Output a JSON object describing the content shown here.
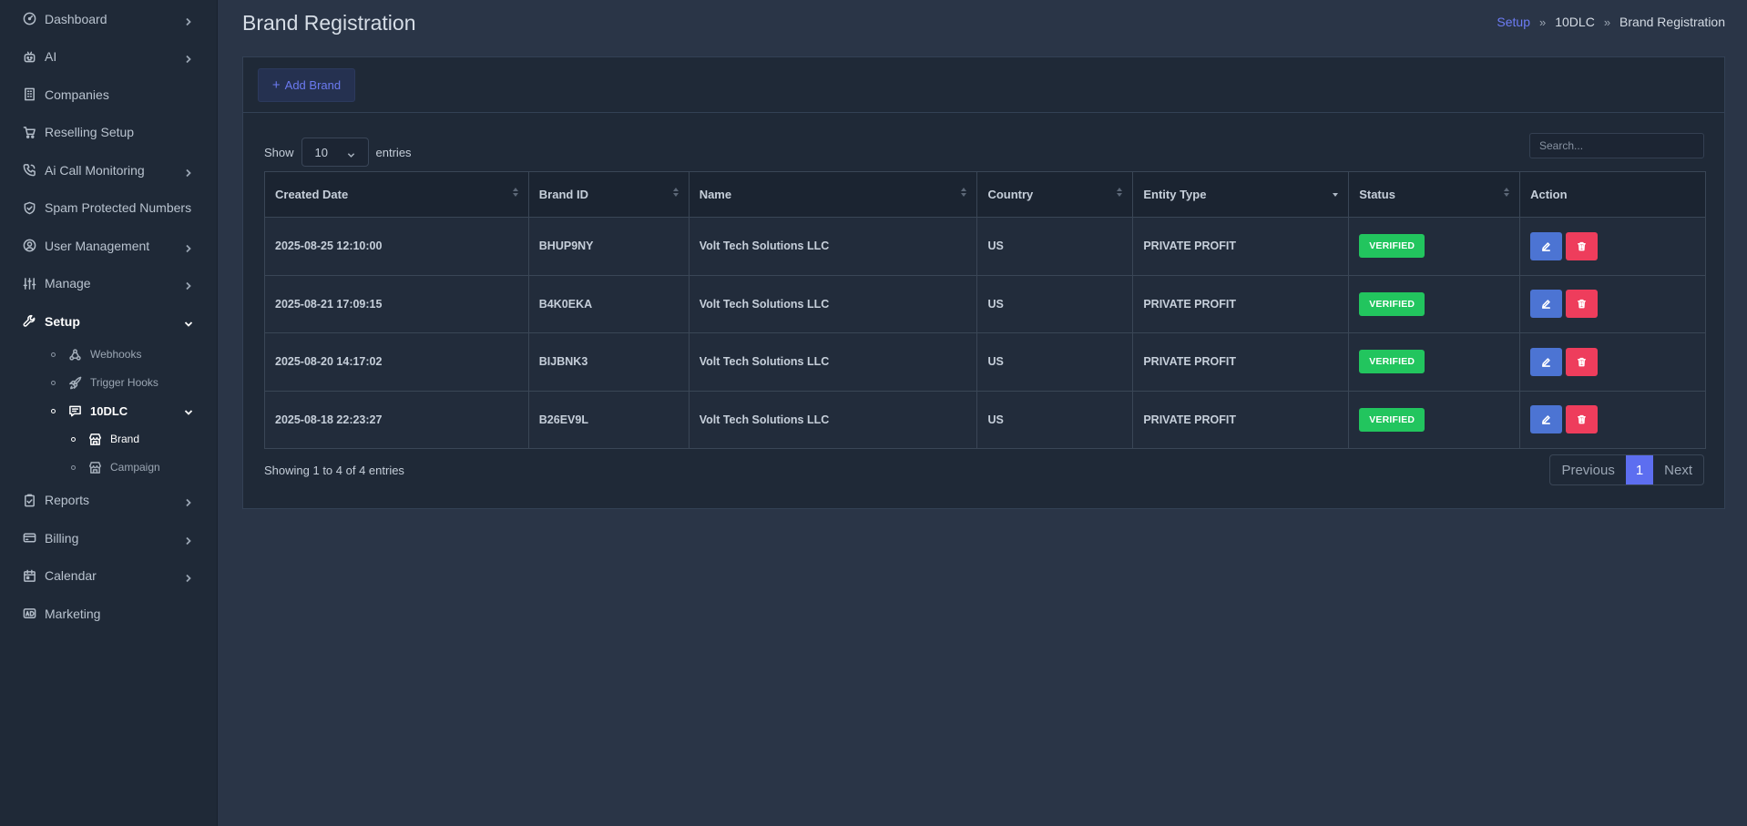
{
  "sidebar": {
    "items": [
      {
        "label": "Dashboard",
        "icon": "dashboard-icon"
      },
      {
        "label": "AI",
        "icon": "robot-icon"
      },
      {
        "label": "Companies",
        "icon": "building-icon"
      },
      {
        "label": "Reselling Setup",
        "icon": "cart-icon"
      },
      {
        "label": "Ai Call Monitoring",
        "icon": "phone-icon"
      },
      {
        "label": "Spam Protected Numbers",
        "icon": "shield-icon"
      },
      {
        "label": "User Management",
        "icon": "user-circle-icon"
      },
      {
        "label": "Manage",
        "icon": "sliders-icon"
      },
      {
        "label": "Setup",
        "icon": "tools-icon"
      },
      {
        "label": "Reports",
        "icon": "clipboard-icon"
      },
      {
        "label": "Billing",
        "icon": "credit-card-icon"
      },
      {
        "label": "Calendar",
        "icon": "calendar-icon"
      },
      {
        "label": "Marketing",
        "icon": "ad-icon"
      }
    ],
    "setup_sub": [
      {
        "label": "Webhooks",
        "icon": "webhook-icon"
      },
      {
        "label": "Trigger Hooks",
        "icon": "rocket-icon"
      },
      {
        "label": "10DLC",
        "icon": "message-icon"
      }
    ],
    "tendlc_sub": [
      {
        "label": "Brand",
        "icon": "store-icon"
      },
      {
        "label": "Campaign",
        "icon": "store-icon"
      }
    ]
  },
  "header": {
    "title": "Brand Registration",
    "breadcrumb": [
      "Setup",
      "10DLC",
      "Brand Registration"
    ],
    "separator": "»"
  },
  "toolbar": {
    "add_label": "Add Brand",
    "show_label": "Show",
    "entries_label": "entries",
    "page_size": "10",
    "search_placeholder": "Search..."
  },
  "table": {
    "columns": [
      "Created Date",
      "Brand ID",
      "Name",
      "Country",
      "Entity Type",
      "Status",
      "Action"
    ],
    "rows": [
      [
        "2025-08-25 12:10:00",
        "BHUP9NY",
        "Volt Tech Solutions LLC",
        "US",
        "PRIVATE PROFIT",
        "VERIFIED"
      ],
      [
        "2025-08-21 17:09:15",
        "B4K0EKA",
        "Volt Tech Solutions LLC",
        "US",
        "PRIVATE PROFIT",
        "VERIFIED"
      ],
      [
        "2025-08-20 14:17:02",
        "BIJBNK3",
        "Volt Tech Solutions LLC",
        "US",
        "PRIVATE PROFIT",
        "VERIFIED"
      ],
      [
        "2025-08-18 22:23:27",
        "B26EV9L",
        "Volt Tech Solutions LLC",
        "US",
        "PRIVATE PROFIT",
        "VERIFIED"
      ]
    ]
  },
  "footer": {
    "showing": "Showing 1 to 4 of 4 entries",
    "prev": "Previous",
    "page": "1",
    "next": "Next"
  },
  "colors": {
    "accent": "#5d6ef0",
    "verified": "#22c55e",
    "edit": "#4c74d3",
    "delete": "#ee3d5c"
  }
}
